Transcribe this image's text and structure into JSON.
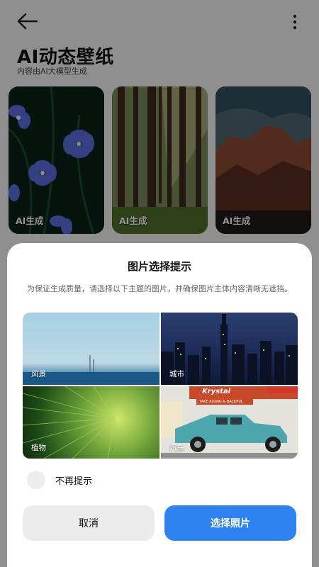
{
  "header": {
    "back_icon": "arrow-left-icon",
    "more_icon": "more-vertical-icon",
    "title": "AI动态壁纸",
    "subtitle": "内容由AI大模型生成"
  },
  "gallery": {
    "cards": [
      {
        "label": "AI生成",
        "subject": "flowers"
      },
      {
        "label": "AI生成",
        "subject": "forest"
      },
      {
        "label": "AI生成",
        "subject": "mountain"
      }
    ]
  },
  "dialog": {
    "title": "图片选择提示",
    "description": "为保证生成质量，请选择以下主题的图片，并确保图片主体内容清晰无遮挡。",
    "examples": [
      {
        "label": "风景"
      },
      {
        "label": "城市"
      },
      {
        "label": "植物"
      },
      {
        "label": "汽车",
        "sign_text": "Krystal",
        "banner_text": "TAKE ALONG & BACKPUL"
      }
    ],
    "dont_show_label": "不再提示",
    "dont_show_checked": false,
    "cancel_label": "取消",
    "choose_label": "选择照片"
  },
  "colors": {
    "primary": "#2f83f0",
    "secondary_button": "#ececec",
    "overlay": "rgba(0,0,0,0.42)"
  }
}
